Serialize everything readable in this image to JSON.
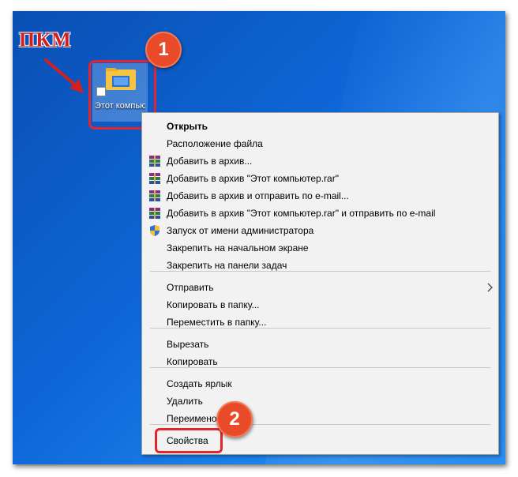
{
  "annotation": {
    "pkm_label": "ПКМ",
    "step1": "1",
    "step2": "2"
  },
  "desktop_icon": {
    "label": "Этот компьютер"
  },
  "menu": {
    "items": [
      {
        "label": "Открыть",
        "bold": true,
        "icon": ""
      },
      {
        "label": "Расположение файла",
        "icon": ""
      },
      {
        "label": "Добавить в архив...",
        "icon": "winrar-icon"
      },
      {
        "label": "Добавить в архив \"Этот компьютер.rar\"",
        "icon": "winrar-icon"
      },
      {
        "label": "Добавить в архив и отправить по e-mail...",
        "icon": "winrar-icon"
      },
      {
        "label": "Добавить в архив \"Этот компьютер.rar\" и отправить по e-mail",
        "icon": "winrar-icon"
      },
      {
        "label": "Запуск от имени администратора",
        "icon": "uac-shield-icon"
      },
      {
        "label": "Закрепить на начальном экране",
        "icon": ""
      },
      {
        "label": "Закрепить на панели задач",
        "icon": ""
      },
      {
        "label": "Отправить",
        "icon": "",
        "submenu": true
      },
      {
        "label": "Копировать в папку...",
        "icon": ""
      },
      {
        "label": "Переместить в папку...",
        "icon": ""
      },
      {
        "label": "Вырезать",
        "icon": ""
      },
      {
        "label": "Копировать",
        "icon": ""
      },
      {
        "label": "Создать ярлык",
        "icon": ""
      },
      {
        "label": "Удалить",
        "icon": ""
      },
      {
        "label": "Переименовать",
        "icon": ""
      },
      {
        "label": "Свойства",
        "icon": ""
      }
    ]
  },
  "colors": {
    "accent_red": "#e3262d",
    "badge_orange": "#e84a2a",
    "desktop_blue": "#0e67d8",
    "menu_bg": "#f2f2f2"
  }
}
